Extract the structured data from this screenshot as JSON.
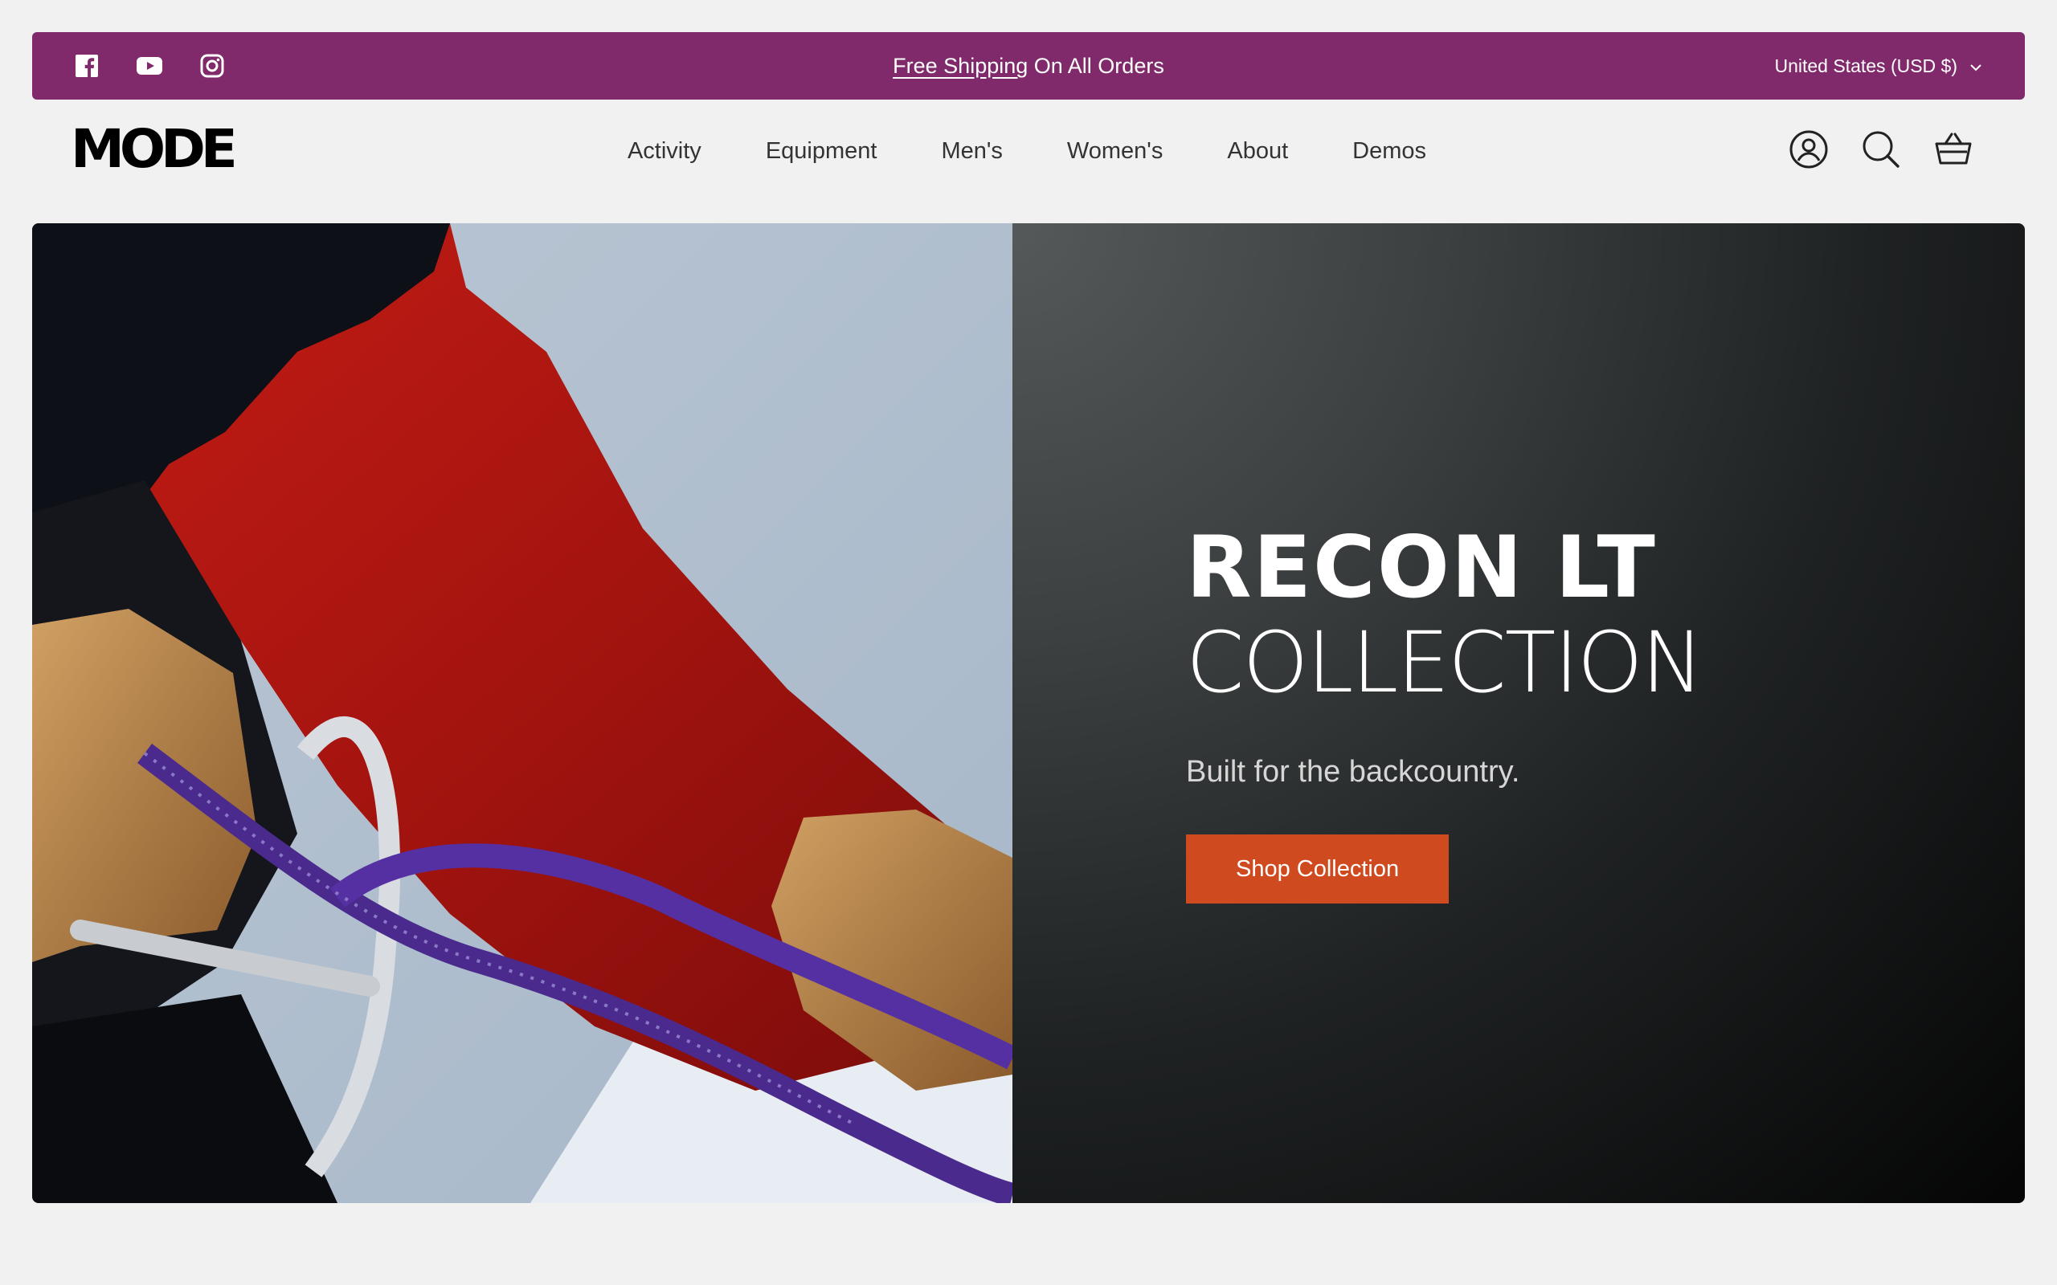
{
  "colors": {
    "announcement_bg": "#812a6b",
    "button_bg": "#cf4a1e"
  },
  "announcement": {
    "link_text": "Free Shipping",
    "rest_text": " On All Orders",
    "currency": "United States (USD $)",
    "social": [
      "facebook-icon",
      "youtube-icon",
      "instagram-icon"
    ]
  },
  "header": {
    "logo": "MODE",
    "nav": [
      "Activity",
      "Equipment",
      "Men's",
      "Women's",
      "About",
      "Demos"
    ],
    "icons": [
      "account-icon",
      "search-icon",
      "cart-icon"
    ]
  },
  "hero": {
    "title_line1": "RECON LT",
    "title_line2": "COLLECTION",
    "subtitle": "Built for the backcountry.",
    "button": "Shop Collection"
  }
}
